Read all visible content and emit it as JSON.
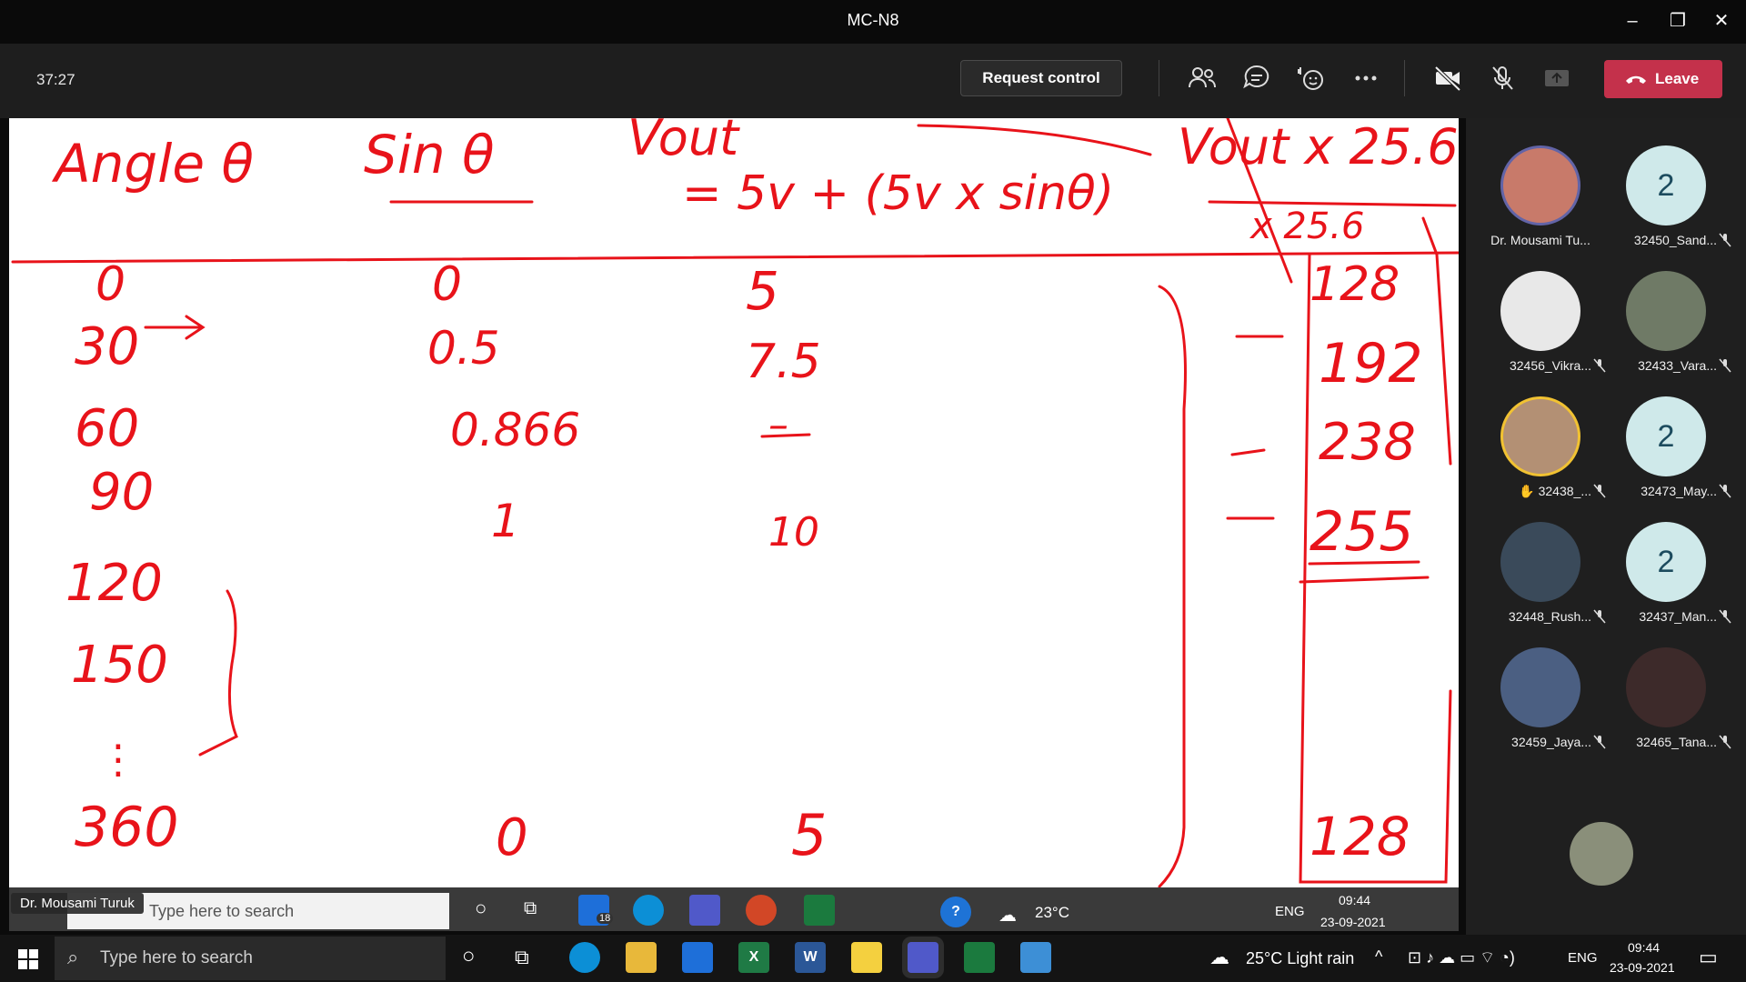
{
  "window": {
    "title": "MC-N8"
  },
  "meeting": {
    "timer": "37:27",
    "request_control": "Request control",
    "leave": "Leave"
  },
  "presenter": {
    "name": "Dr. Mousami Turuk"
  },
  "whiteboard": {
    "headers": [
      "Angle θ",
      "Sin θ",
      "Vout",
      "= 5v + (5v x sinθ)",
      "Vout x 25.6",
      "x 25.6"
    ],
    "angle": [
      "0",
      "30",
      "60",
      "90",
      "120",
      "150",
      "⋮",
      "360"
    ],
    "sin": [
      "0",
      "0.5",
      "0.866",
      "1",
      "0"
    ],
    "vout": [
      "5",
      "7.5",
      "–",
      "10",
      "5"
    ],
    "scaled": [
      "128",
      "192",
      "238",
      "255",
      "128"
    ]
  },
  "participants": [
    {
      "name": "Dr. Mousami Tu...",
      "initials": "",
      "muted": false
    },
    {
      "name": "32450_Sand...",
      "initials": "2",
      "muted": true
    },
    {
      "name": "32456_Vikra...",
      "initials": "",
      "muted": true
    },
    {
      "name": "32433_Vara...",
      "initials": "",
      "muted": true
    },
    {
      "name": "32438_...",
      "initials": "",
      "muted": true,
      "hand": "✋"
    },
    {
      "name": "32473_May...",
      "initials": "2",
      "muted": true
    },
    {
      "name": "32448_Rush...",
      "initials": "",
      "muted": true
    },
    {
      "name": "32437_Man...",
      "initials": "2",
      "muted": true
    },
    {
      "name": "32459_Jaya...",
      "initials": "",
      "muted": true
    },
    {
      "name": "32465_Tana...",
      "initials": "",
      "muted": true
    }
  ],
  "remote_taskbar": {
    "search": "Type here to search",
    "mail_badge": "18",
    "temp": "23°C",
    "lang": "ENG",
    "time": "09:44",
    "date": "23-09-2021"
  },
  "taskbar": {
    "search": "Type here to search",
    "weather": "25°C  Light rain",
    "lang": "ENG",
    "time": "09:44",
    "date": "23-09-2021"
  },
  "colors": {
    "ink": "#e8131a",
    "leave": "#c4314b",
    "avatar_init_bg": "#cfe9ea"
  }
}
